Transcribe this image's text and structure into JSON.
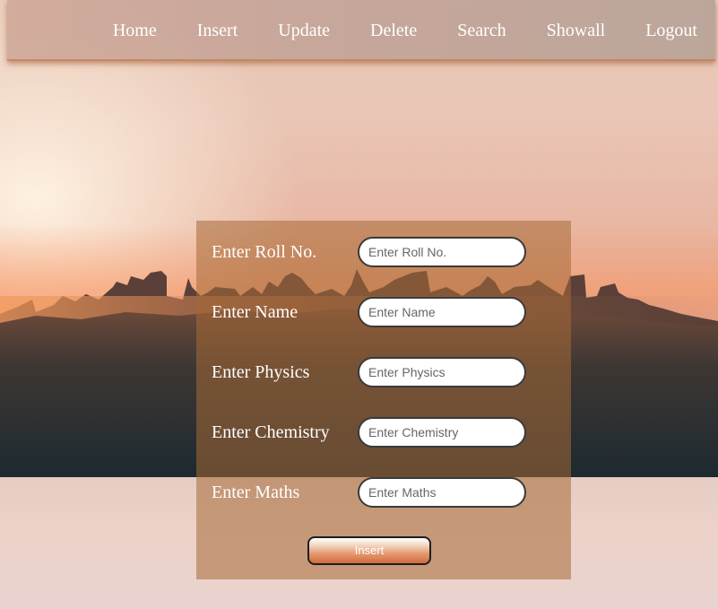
{
  "nav": {
    "items": [
      {
        "label": "Home"
      },
      {
        "label": "Insert"
      },
      {
        "label": "Update"
      },
      {
        "label": "Delete"
      },
      {
        "label": "Search"
      },
      {
        "label": "Showall"
      },
      {
        "label": "Logout"
      }
    ]
  },
  "form": {
    "fields": [
      {
        "label": "Enter Roll No.",
        "placeholder": "Enter Roll No.",
        "value": ""
      },
      {
        "label": "Enter Name",
        "placeholder": "Enter Name",
        "value": ""
      },
      {
        "label": "Enter Physics",
        "placeholder": "Enter Physics",
        "value": ""
      },
      {
        "label": "Enter Chemistry",
        "placeholder": "Enter Chemistry",
        "value": ""
      },
      {
        "label": "Enter Maths",
        "placeholder": "Enter Maths",
        "value": ""
      }
    ],
    "submit_label": "Insert"
  },
  "colors": {
    "nav_text": "#ffffff",
    "panel": "#a56937",
    "button_accent": "#d06c3c"
  }
}
